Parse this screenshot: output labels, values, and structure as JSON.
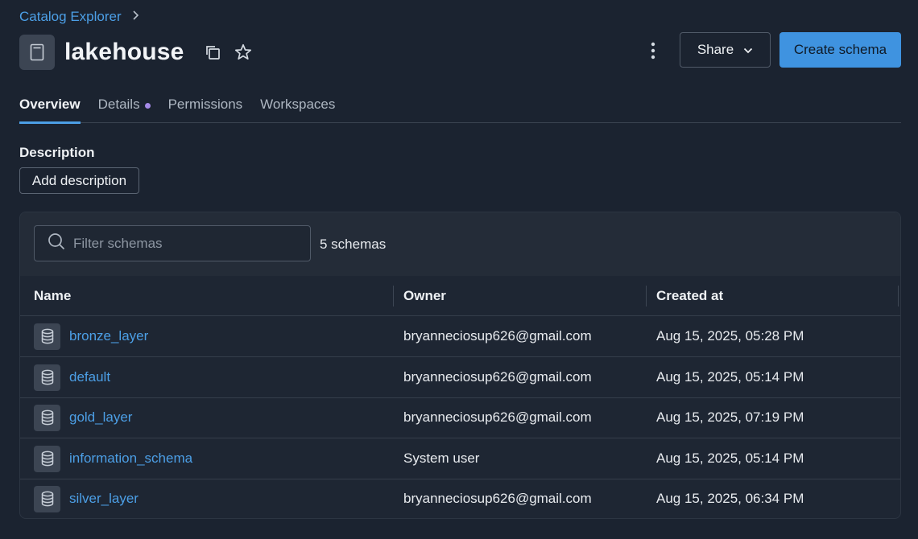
{
  "breadcrumb": {
    "root": "Catalog Explorer"
  },
  "header": {
    "title": "lakehouse",
    "share_label": "Share",
    "create_label": "Create schema"
  },
  "tabs": [
    {
      "label": "Overview",
      "active": true
    },
    {
      "label": "Details",
      "active": false,
      "has_dot": true
    },
    {
      "label": "Permissions",
      "active": false
    },
    {
      "label": "Workspaces",
      "active": false
    }
  ],
  "description": {
    "label": "Description",
    "add_label": "Add description"
  },
  "schemas": {
    "filter_placeholder": "Filter schemas",
    "count_text": "5 schemas",
    "columns": [
      "Name",
      "Owner",
      "Created at"
    ],
    "rows": [
      {
        "name": "bronze_layer",
        "owner": "bryanneciosup626@gmail.com",
        "created": "Aug 15, 2025, 05:28 PM"
      },
      {
        "name": "default",
        "owner": "bryanneciosup626@gmail.com",
        "created": "Aug 15, 2025, 05:14 PM"
      },
      {
        "name": "gold_layer",
        "owner": "bryanneciosup626@gmail.com",
        "created": "Aug 15, 2025, 07:19 PM"
      },
      {
        "name": "information_schema",
        "owner": "System user",
        "created": "Aug 15, 2025, 05:14 PM"
      },
      {
        "name": "silver_layer",
        "owner": "bryanneciosup626@gmail.com",
        "created": "Aug 15, 2025, 06:34 PM"
      }
    ]
  },
  "colors": {
    "background": "#1b2330",
    "accent": "#3f93e0",
    "link": "#4c9fe6",
    "dot": "#a58ae8"
  },
  "icons": [
    "catalog-icon",
    "copy-icon",
    "star-icon",
    "kebab-icon",
    "chevron-down-icon",
    "search-icon",
    "database-icon",
    "chevron-right-icon"
  ]
}
